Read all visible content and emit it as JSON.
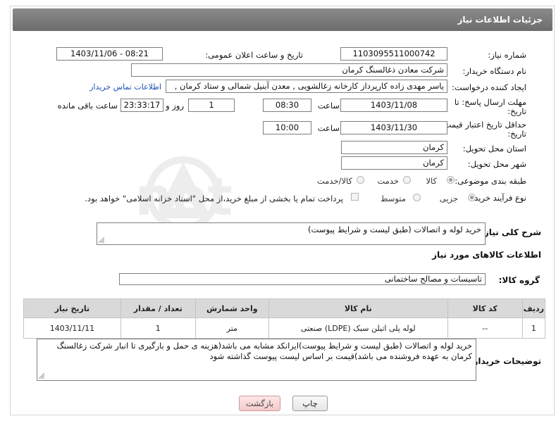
{
  "header": {
    "title": "جزئیات اطلاعات نیاز"
  },
  "form": {
    "need_number_label": "شماره نیاز:",
    "need_number": "1103095511000742",
    "announce_label": "تاریخ و ساعت اعلان عمومی:",
    "announce_value": "1403/11/06 - 08:21",
    "buyer_org_label": "نام دستگاه خریدار:",
    "buyer_org": "شرکت معادن ذغالسنگ کرمان",
    "creator_label": "ایجاد کننده درخواست:",
    "creator": "یاسر مهدی زاده کارپرداز کارخانه زغالشویی , معدن آبنیل شمالی و ستاد کرمان ,",
    "contact_link": "اطلاعات تماس خریدار",
    "reply_deadline_label_1": "مهلت ارسال پاسخ: تا",
    "reply_deadline_label_2": "تاریخ:",
    "reply_date": "1403/11/08",
    "time_label": "ساعت",
    "reply_time": "08:30",
    "days_value": "1",
    "days_label": "روز و",
    "remaining_time": "23:33:17",
    "remaining_label": "ساعت باقی مانده",
    "price_validity_label_1": "حداقل تاریخ اعتبار قیمت: تا",
    "price_validity_label_2": "تاریخ:",
    "price_date": "1403/11/30",
    "price_time": "10:00",
    "province_label": "استان محل تحویل:",
    "province": "کرمان",
    "city_label": "شهر محل تحویل:",
    "city": "کرمان",
    "category_label": "طبقه بندی موضوعی:",
    "category_options": [
      "کالا",
      "خدمت",
      "کالا/خدمت"
    ],
    "category_selected": "کالا",
    "process_label": "نوع فرآیند خرید :",
    "process_options": [
      "جزیی",
      "متوسط"
    ],
    "payment_note": "پرداخت تمام یا بخشی از مبلغ خرید،از محل \"اسناد خزانه اسلامی\" خواهد بود.",
    "description_label": "شرح کلی نیاز:",
    "description": "خرید لوله و اتصالات (طبق لیست و شرایط پیوست)"
  },
  "goods": {
    "section_title": "اطلاعات کالاهای مورد نیاز",
    "group_label": "گروه کالا:",
    "group_value": "تاسیسات و مصالح ساختمانی",
    "columns": [
      "ردیف",
      "کد کالا",
      "نام کالا",
      "واحد شمارش",
      "تعداد / مقدار",
      "تاریخ نیاز"
    ],
    "rows": [
      [
        "1",
        "--",
        "لوله پلی اتیلن سبک (LDPE) صنعتی",
        "متر",
        "1",
        "1403/11/11"
      ]
    ]
  },
  "buyer_notes": {
    "label": "توضیحات خریدار:",
    "text": "خرید لوله و اتصالات (طبق لیست و شرایط پیوست)ایرانکد مشابه می باشد(هزینه ی حمل و بارگیری تا انبار شرکت زغالسنگ کرمان به عهده فروشنده می باشد)قیمت بر اساس لیست پیوست گذاشته شود"
  },
  "buttons": {
    "print": "چاپ",
    "back": "بازگشت"
  },
  "watermark_text": "AriaTender.net"
}
